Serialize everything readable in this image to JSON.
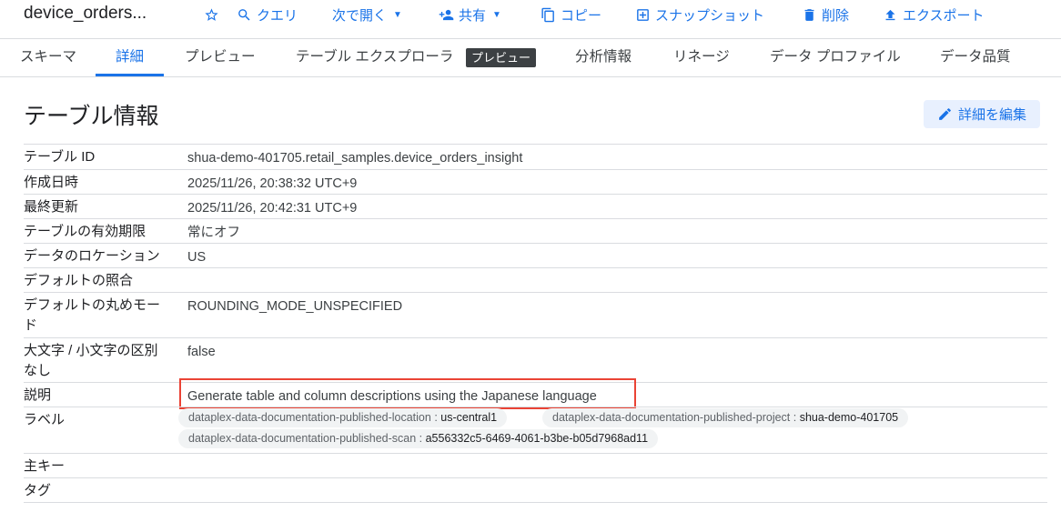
{
  "toolbar": {
    "title": "device_orders...",
    "star_label": "",
    "query": "クエリ",
    "open_in": "次で開く",
    "share": "共有",
    "copy": "コピー",
    "snapshot": "スナップショット",
    "delete": "削除",
    "export": "エクスポート"
  },
  "tabs": [
    {
      "label": "スキーマ"
    },
    {
      "label": "詳細"
    },
    {
      "label": "プレビュー"
    },
    {
      "label": "テーブル エクスプローラ"
    },
    {
      "label": "分析情報"
    },
    {
      "label": "リネージ"
    },
    {
      "label": "データ プロファイル"
    },
    {
      "label": "データ品質"
    }
  ],
  "tab_badge": "プレビュー",
  "active_tab": "詳細",
  "section": {
    "title": "テーブル情報",
    "edit_button": "詳細を編集"
  },
  "rows": [
    {
      "key": "テーブル ID",
      "value": "shua-demo-401705.retail_samples.device_orders_insight"
    },
    {
      "key": "作成日時",
      "value": "2025/11/26, 20:38:32 UTC+9"
    },
    {
      "key": "最終更新",
      "value": "2025/11/26, 20:42:31 UTC+9"
    },
    {
      "key": "テーブルの有効期限",
      "value": "常にオフ"
    },
    {
      "key": "データのロケーション",
      "value": "US"
    },
    {
      "key": "デフォルトの照合",
      "value": ""
    },
    {
      "key": "デフォルトの丸めモード",
      "value": "ROUNDING_MODE_UNSPECIFIED"
    },
    {
      "key": "大文字 / 小文字の区別なし",
      "value": "false"
    },
    {
      "key": "説明",
      "value": "Generate table and column descriptions using the Japanese language"
    },
    {
      "key": "ラベル",
      "value": ""
    },
    {
      "key": "主キー",
      "value": ""
    },
    {
      "key": "タグ",
      "value": ""
    }
  ],
  "labels": [
    {
      "key": "dataplex-data-documentation-published-location",
      "value": "us-central1"
    },
    {
      "key": "dataplex-data-documentation-published-project",
      "value": "shua-demo-401705"
    },
    {
      "key": "dataplex-data-documentation-published-scan",
      "value": "a556332c5-6469-4061-b3be-b05d7968ad11"
    }
  ],
  "colors": {
    "accent": "#1a73e8",
    "highlight_border": "#ea4335",
    "badge_bg": "#3c4043"
  },
  "icons": [
    "star-icon",
    "search-icon",
    "chevron-down-icon",
    "person-add-icon",
    "copy-icon",
    "snapshot-icon",
    "trash-icon",
    "upload-icon",
    "pencil-icon"
  ]
}
